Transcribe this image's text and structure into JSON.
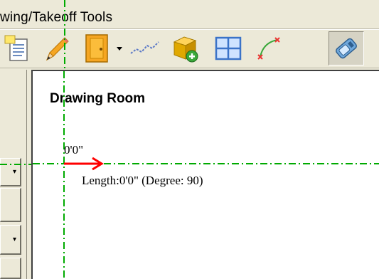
{
  "toolbar": {
    "title": "wing/Takeoff Tools",
    "icons": [
      "notes-icon",
      "pencil-icon",
      "door-icon",
      "dropdown-arrow-icon",
      "polyline-icon",
      "add-box-icon",
      "window-grid-icon",
      "curve-icon",
      "measure-tool-icon"
    ]
  },
  "canvas": {
    "title": "Drawing Room",
    "coordinate": "0'0\"",
    "length_readout": "Length:0'0\" (Degree: 90)"
  },
  "colors": {
    "guide": "#00aa00",
    "arrow": "#ff0000",
    "window_bg": "#ece9d8"
  }
}
